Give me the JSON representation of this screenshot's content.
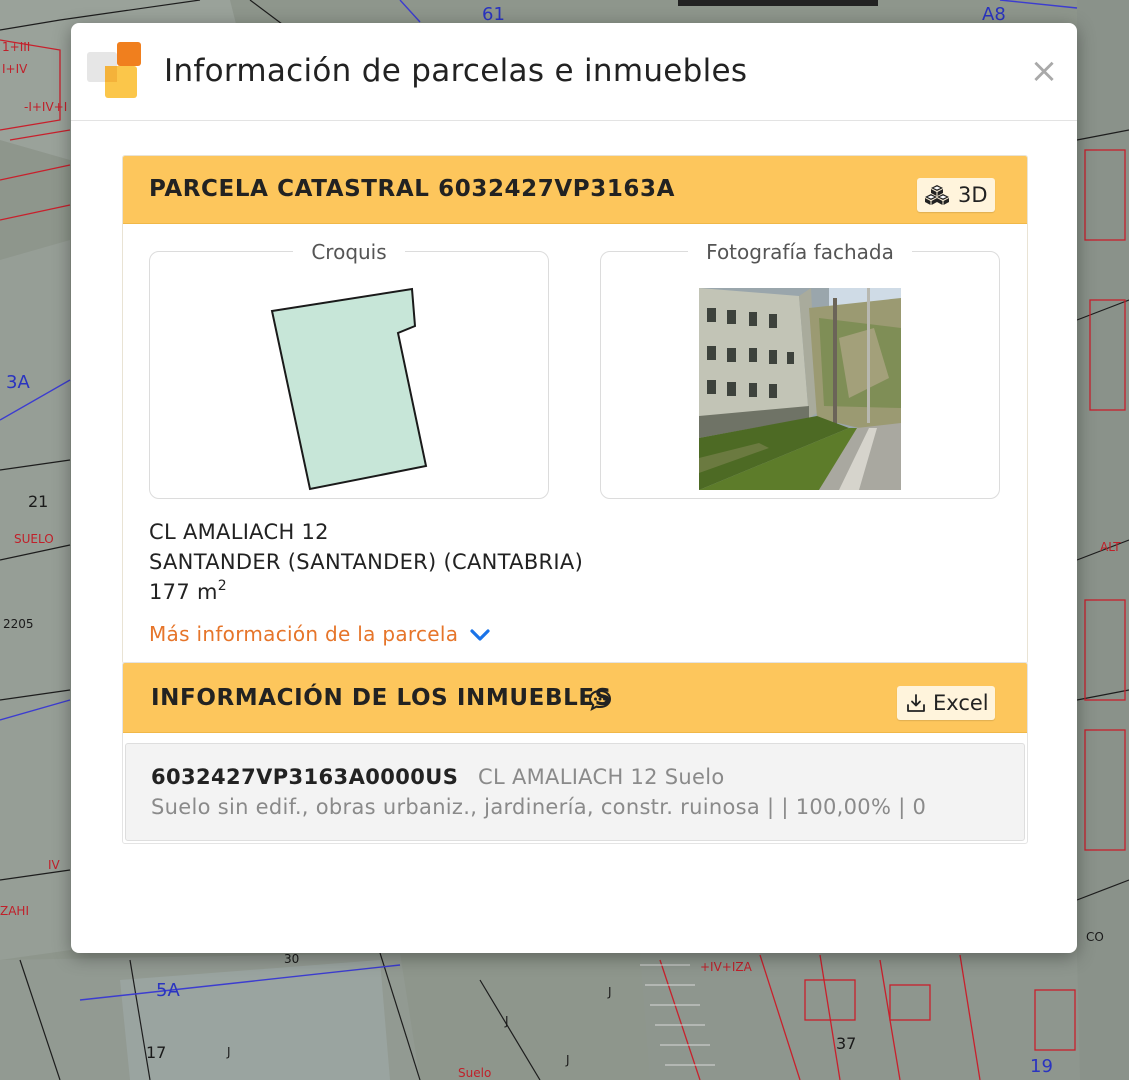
{
  "map": {
    "labels": [
      "61",
      "A8",
      "3A",
      "21",
      "SUELO",
      "2205",
      "ALT",
      "5A",
      "17",
      "30",
      "37",
      "CO",
      "Suelo",
      "J",
      "J",
      "J",
      "J",
      "I+IV",
      "-I+IV+I",
      "1+III",
      "IV",
      "ZAHI",
      "19",
      "+IV+IZA"
    ]
  },
  "modal": {
    "title": "Información de parcelas e inmuebles",
    "close_symbol": "×"
  },
  "parcel": {
    "heading": "PARCELA CATASTRAL 6032427VP3163A",
    "btn_3d_label": "3D",
    "sketch_legend": "Croquis",
    "photo_legend": "Fotografía fachada",
    "address_street": "CL AMALIACH 12",
    "address_city": "SANTANDER (SANTANDER) (CANTABRIA)",
    "area_value": "177 m",
    "area_exponent": "2",
    "more_info_link": "Más información de la parcela"
  },
  "properties": {
    "heading": "INFORMACIÓN DE LOS INMUEBLES",
    "excel_label": "Excel",
    "items": [
      {
        "ref": "6032427VP3163A0000US",
        "address": "CL AMALIACH 12 Suelo",
        "detail": "Suelo sin edif., obras urbaniz., jardinería, constr. ruinosa | | 100,00% | 0"
      }
    ]
  },
  "colors": {
    "header_orange": "#fdc65c",
    "link_orange": "#e6752a",
    "chevron_blue": "#1a73e8",
    "sketch_fill": "#c7e6d8"
  },
  "icons": [
    "app-logo-icon",
    "close-icon",
    "cubes-3d-icon",
    "chevron-down-icon",
    "comment-dots-icon",
    "download-icon"
  ]
}
